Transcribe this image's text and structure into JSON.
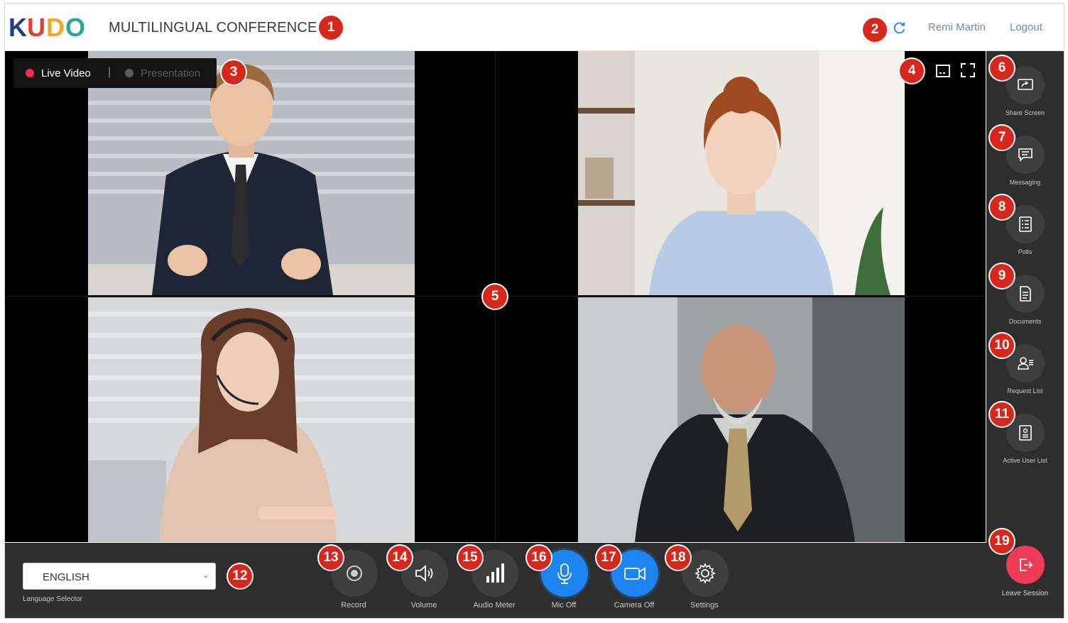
{
  "header": {
    "title": "MULTILINGUAL CONFERENCE",
    "user_name": "Remi Martin",
    "logout_label": "Logout",
    "logo_letters": [
      "K",
      "U",
      "D",
      "O"
    ]
  },
  "video": {
    "view_toggle": {
      "live_label": "Live Video",
      "separator": "|",
      "presentation_label": "Presentation",
      "live_active": true
    },
    "participants": [
      {
        "position": "top-left",
        "description_icon": "man-in-suit-speaking"
      },
      {
        "position": "top-right",
        "description_icon": "woman-in-blue-shirt"
      },
      {
        "position": "bottom-left",
        "description_icon": "woman-with-headset"
      },
      {
        "position": "bottom-right",
        "description_icon": "bald-man-with-beard"
      }
    ]
  },
  "sidebar": {
    "items": [
      {
        "label": "Share Screen",
        "icon": "share-screen-icon"
      },
      {
        "label": "Messaging",
        "icon": "chat-icon"
      },
      {
        "label": "Polls",
        "icon": "poll-icon"
      },
      {
        "label": "Documents",
        "icon": "document-icon"
      },
      {
        "label": "Request List",
        "icon": "request-list-icon"
      },
      {
        "label": "Active User List",
        "icon": "user-list-icon"
      }
    ],
    "leave_label": "Leave Session"
  },
  "bottom": {
    "language": {
      "value": "ENGLISH",
      "label": "Language Selector"
    },
    "controls": [
      {
        "label": "Record",
        "icon": "record-icon",
        "active": false
      },
      {
        "label": "Volume",
        "icon": "volume-icon",
        "active": false
      },
      {
        "label": "Audio Meter",
        "icon": "audio-meter-icon",
        "active": false
      },
      {
        "label": "Mic Off",
        "icon": "mic-icon",
        "active": true
      },
      {
        "label": "Camera Off",
        "icon": "camera-icon",
        "active": true
      },
      {
        "label": "Settings",
        "icon": "gear-icon",
        "active": false
      }
    ]
  },
  "callouts": [
    "1",
    "2",
    "3",
    "4",
    "5",
    "6",
    "7",
    "8",
    "9",
    "10",
    "11",
    "12",
    "13",
    "14",
    "15",
    "16",
    "17",
    "18",
    "19"
  ],
  "colors": {
    "accent_blue": "#1e84f0",
    "leave_red": "#ef3b55",
    "live_dot": "#e8334a",
    "callout_red": "#d7261b",
    "sidebar_bg": "#2e2e2e"
  }
}
